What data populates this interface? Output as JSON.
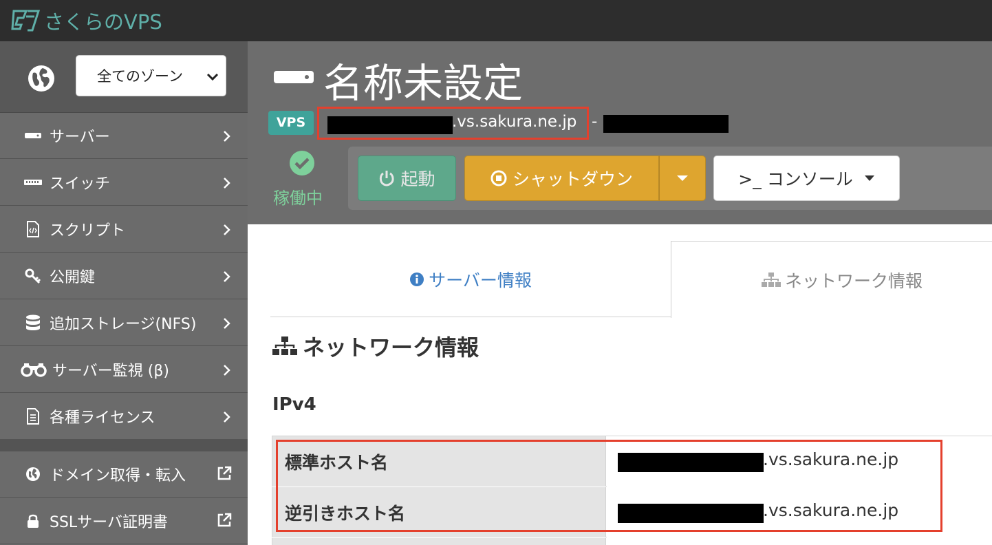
{
  "app": {
    "logo_text": "さくらのVPS"
  },
  "sidebar": {
    "zone_select": {
      "value": "全てのゾーン"
    },
    "items": [
      {
        "label": "サーバー",
        "icon": "server-icon"
      },
      {
        "label": "スイッチ",
        "icon": "switch-icon"
      },
      {
        "label": "スクリプト",
        "icon": "script-icon"
      },
      {
        "label": "公開鍵",
        "icon": "key-icon"
      },
      {
        "label": "追加ストレージ(NFS)",
        "icon": "database-icon"
      },
      {
        "label": "サーバー監視 (β)",
        "icon": "binoculars-icon"
      },
      {
        "label": "各種ライセンス",
        "icon": "document-icon"
      }
    ],
    "external_items": [
      {
        "label": "ドメイン取得・転入",
        "icon": "globe-icon"
      },
      {
        "label": "SSLサーバ証明書",
        "icon": "lock-icon"
      }
    ]
  },
  "header": {
    "title": "名称未設定",
    "badge": "VPS",
    "hostname_suffix": ".vs.sakura.ne.jp",
    "separator": "-",
    "status": "稼働中",
    "buttons": {
      "start": "起動",
      "shutdown": "シャットダウン",
      "console": ">_ コンソール"
    }
  },
  "tabs": {
    "server_info": "サーバー情報",
    "network_info": "ネットワーク情報"
  },
  "network": {
    "section_title": "ネットワーク情報",
    "ipv4_title": "IPv4",
    "rows": [
      {
        "label": "標準ホスト名",
        "value_suffix": ".vs.sakura.ne.jp"
      },
      {
        "label": "逆引きホスト名",
        "value_suffix": ".vs.sakura.ne.jp"
      }
    ]
  },
  "colors": {
    "topbar": "#2d2d2d",
    "sidebar": "#6b6b6b",
    "accent_teal": "#3fa39a",
    "start_green": "#5ea88b",
    "shutdown_yellow": "#dea52f",
    "highlight_red": "#e4402d",
    "tab_link_blue": "#3f7fc4"
  }
}
